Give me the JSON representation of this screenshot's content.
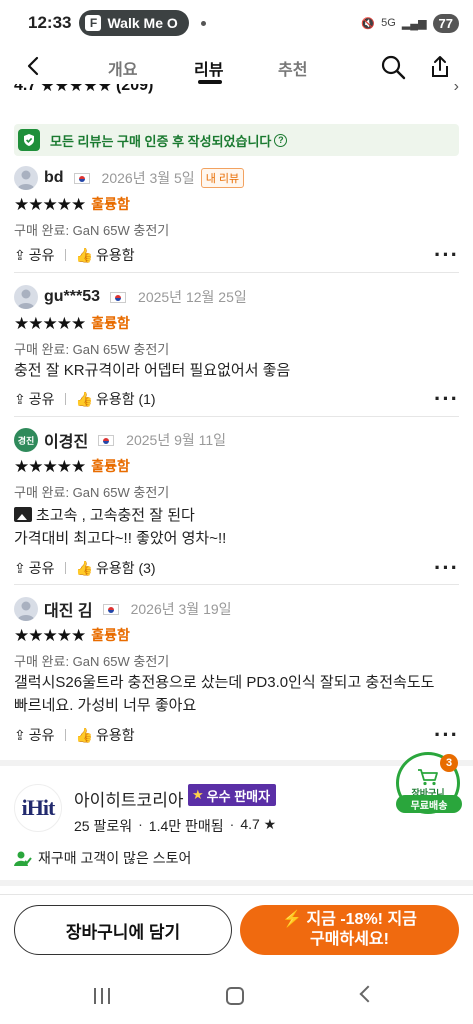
{
  "status_bar": {
    "time": "12:33",
    "app_pill": "Walk Me O",
    "network": "5G",
    "battery": "77"
  },
  "header": {
    "tabs": [
      {
        "label": "개요"
      },
      {
        "label": "리뷰"
      },
      {
        "label": "추천"
      }
    ],
    "active_tab": "리뷰"
  },
  "rating_summary": {
    "score": "4.7",
    "count": "(209)"
  },
  "verified_banner": {
    "text": "모든 리뷰는 구매 인증 후 작성되었습니다",
    "icon": "shield-check-icon"
  },
  "reviews": [
    {
      "user": "bd",
      "avatar": "person-icon",
      "date": "2026년 3월 5일",
      "badge": "내 리뷰",
      "grade": "훌륭함",
      "purchase": "구매 완료: GaN 65W 충전기",
      "text_lines": [],
      "share": "공유",
      "helpful": "유용함"
    },
    {
      "user": "gu***53",
      "avatar": "person-icon",
      "date": "2025년 12월 25일",
      "grade": "훌륭함",
      "purchase": "구매 완료: GaN 65W 충전기",
      "text_lines": [
        "충전 잘 KR규격이라 어뎁터 필요없어서 좋음"
      ],
      "share": "공유",
      "helpful": "유용함 (1)"
    },
    {
      "user": "이경진",
      "avatar_text": "경진",
      "date": "2025년 9월 11일",
      "grade": "훌륭함",
      "purchase": "구매 완료: GaN 65W 충전기",
      "text_lines": [
        "초고속 , 고속충전 잘 된다",
        "가격대비 최고다~!! 좋았어 영차~!!"
      ],
      "share": "공유",
      "helpful": "유용함 (3)"
    },
    {
      "user": "대진 김",
      "avatar": "person-icon",
      "date": "2026년 3월 19일",
      "grade": "훌륭함",
      "purchase": "구매 완료: GaN 65W 충전기",
      "text_lines": [
        "갤럭시S26울트라 충전용으로 샀는데 PD3.0인식 잘되고 충전속도도",
        "빠르네요. 가성비 너무 좋아요"
      ],
      "share": "공유",
      "helpful": "유용함"
    }
  ],
  "seller": {
    "logo_text": "iHit",
    "name": "아이히트코리아",
    "badge": "우수 판매자",
    "followers": "25 팔로워",
    "sold": "1.4만 판매됨",
    "rating": "4.7 ★",
    "note": "재구매 고객이 많은 스토어"
  },
  "floating_cart": {
    "label": "장바구니",
    "count": "3",
    "free_shipping": "무료배송"
  },
  "bottom_bar": {
    "cart_button": "장바구니에 담기",
    "buy_line1": "⚡ 지금 -18%! 지금",
    "buy_line2": "구매하세요!"
  },
  "colors": {
    "accent_orange": "#f06a0f",
    "grade_orange": "#e86c00",
    "verified_green": "#1a7a30",
    "seller_badge_purple": "#5a2fa6"
  }
}
